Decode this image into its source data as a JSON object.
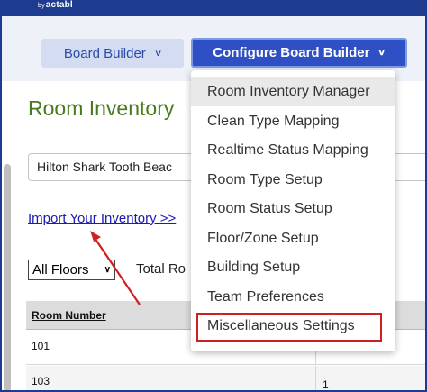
{
  "brand": {
    "by": "by",
    "name": "actabl"
  },
  "nav": {
    "board_builder": "Board Builder",
    "configure_board_builder": "Configure Board Builder"
  },
  "page": {
    "title": "Room Inventory",
    "property_select": "Hilton Shark Tooth Beac",
    "import_link": "Import Your Inventory >>",
    "floors_select": "All Floors",
    "total_label": "Total Ro"
  },
  "table": {
    "header": "Room Number",
    "rows": [
      {
        "room": "101",
        "value": ""
      },
      {
        "room": "103",
        "value": "1"
      }
    ]
  },
  "dropdown": {
    "items": [
      "Room Inventory Manager",
      "Clean Type Mapping",
      "Realtime Status Mapping",
      "Room Type Setup",
      "Room Status Setup",
      "Floor/Zone Setup",
      "Building Setup",
      "Team Preferences",
      "Miscellaneous Settings"
    ],
    "hovered_index": 0,
    "highlighted_index": 8
  },
  "colors": {
    "topbar": "#1e3c8f",
    "configure_button": "#2f50c4",
    "page_title": "#4a7a1e",
    "link": "#1a1ab4",
    "annotation": "#d01f1f"
  }
}
